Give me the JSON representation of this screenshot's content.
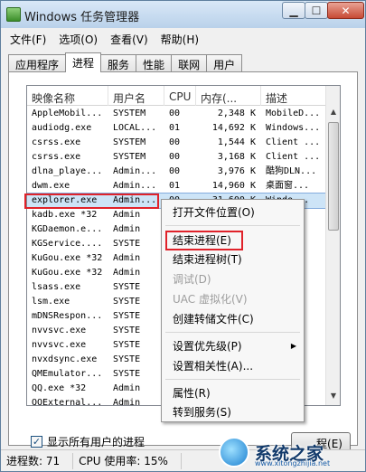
{
  "window": {
    "title": "Windows 任务管理器"
  },
  "menubar": {
    "items": [
      "文件(F)",
      "选项(O)",
      "查看(V)",
      "帮助(H)"
    ]
  },
  "tabs": [
    "应用程序",
    "进程",
    "服务",
    "性能",
    "联网",
    "用户"
  ],
  "active_tab": "进程",
  "columns": [
    "映像名称",
    "用户名",
    "CPU",
    "内存(...",
    "描述"
  ],
  "processes": [
    {
      "name": "AppleMobil...",
      "user": "SYSTEM",
      "cpu": "00",
      "mem": "2,348 K",
      "desc": "MobileD..."
    },
    {
      "name": "audiodg.exe",
      "user": "LOCAL...",
      "cpu": "01",
      "mem": "14,692 K",
      "desc": "Windows..."
    },
    {
      "name": "csrss.exe",
      "user": "SYSTEM",
      "cpu": "00",
      "mem": "1,544 K",
      "desc": "Client ..."
    },
    {
      "name": "csrss.exe",
      "user": "SYSTEM",
      "cpu": "00",
      "mem": "3,168 K",
      "desc": "Client ..."
    },
    {
      "name": "dlna_playe...",
      "user": "Admin...",
      "cpu": "00",
      "mem": "3,976 K",
      "desc": "酷狗DLN..."
    },
    {
      "name": "dwm.exe",
      "user": "Admin...",
      "cpu": "01",
      "mem": "14,960 K",
      "desc": "桌面窗..."
    },
    {
      "name": "explorer.exe",
      "user": "Admin...",
      "cpu": "00",
      "mem": "31,600 K",
      "desc": "Windo..."
    },
    {
      "name": "kadb.exe *32",
      "user": "Admin",
      "cpu": "",
      "mem": "",
      "desc": ""
    },
    {
      "name": "KGDaemon.e...",
      "user": "Admin",
      "cpu": "",
      "mem": "",
      "desc": ""
    },
    {
      "name": "KGService....",
      "user": "SYSTE",
      "cpu": "",
      "mem": "",
      "desc": ""
    },
    {
      "name": "KuGou.exe *32",
      "user": "Admin",
      "cpu": "",
      "mem": "",
      "desc": ""
    },
    {
      "name": "KuGou.exe *32",
      "user": "Admin",
      "cpu": "",
      "mem": "",
      "desc": ""
    },
    {
      "name": "lsass.exe",
      "user": "SYSTE",
      "cpu": "",
      "mem": "",
      "desc": ""
    },
    {
      "name": "lsm.exe",
      "user": "SYSTE",
      "cpu": "",
      "mem": "",
      "desc": ""
    },
    {
      "name": "mDNSRespon...",
      "user": "SYSTE",
      "cpu": "",
      "mem": "",
      "desc": ""
    },
    {
      "name": "nvvsvc.exe",
      "user": "SYSTE",
      "cpu": "",
      "mem": "",
      "desc": ""
    },
    {
      "name": "nvvsvc.exe",
      "user": "SYSTE",
      "cpu": "",
      "mem": "",
      "desc": ""
    },
    {
      "name": "nvxdsync.exe",
      "user": "SYSTE",
      "cpu": "",
      "mem": "",
      "desc": ""
    },
    {
      "name": "QMEmulator...",
      "user": "SYSTE",
      "cpu": "",
      "mem": "",
      "desc": ""
    },
    {
      "name": "QQ.exe *32",
      "user": "Admin",
      "cpu": "",
      "mem": "",
      "desc": ""
    },
    {
      "name": "QQExternal...",
      "user": "Admin",
      "cpu": "",
      "mem": "",
      "desc": ""
    }
  ],
  "selected_process_index": 6,
  "show_all_users_label": "显示所有用户的进程",
  "end_process_button": "程(E)",
  "status": {
    "process_count": "进程数: 71",
    "cpu_usage": "CPU 使用率: 15%"
  },
  "context_menu": {
    "items": [
      {
        "label": "打开文件位置(O)",
        "disabled": false
      },
      {
        "label": "结束进程(E)",
        "disabled": false
      },
      {
        "label": "结束进程树(T)",
        "disabled": false
      },
      {
        "label": "调试(D)",
        "disabled": true
      },
      {
        "label": "UAC 虚拟化(V)",
        "disabled": true
      },
      {
        "label": "创建转储文件(C)",
        "disabled": false
      },
      {
        "label": "设置优先级(P)",
        "disabled": false,
        "submenu": true
      },
      {
        "label": "设置相关性(A)...",
        "disabled": false
      },
      {
        "label": "属性(R)",
        "disabled": false
      },
      {
        "label": "转到服务(S)",
        "disabled": false
      }
    ]
  },
  "watermark": {
    "text": "系统之家",
    "url": "www.xitongzhijia.net"
  },
  "colors": {
    "highlight_red": "#e0222a",
    "selected_row": "#cde4f7"
  }
}
